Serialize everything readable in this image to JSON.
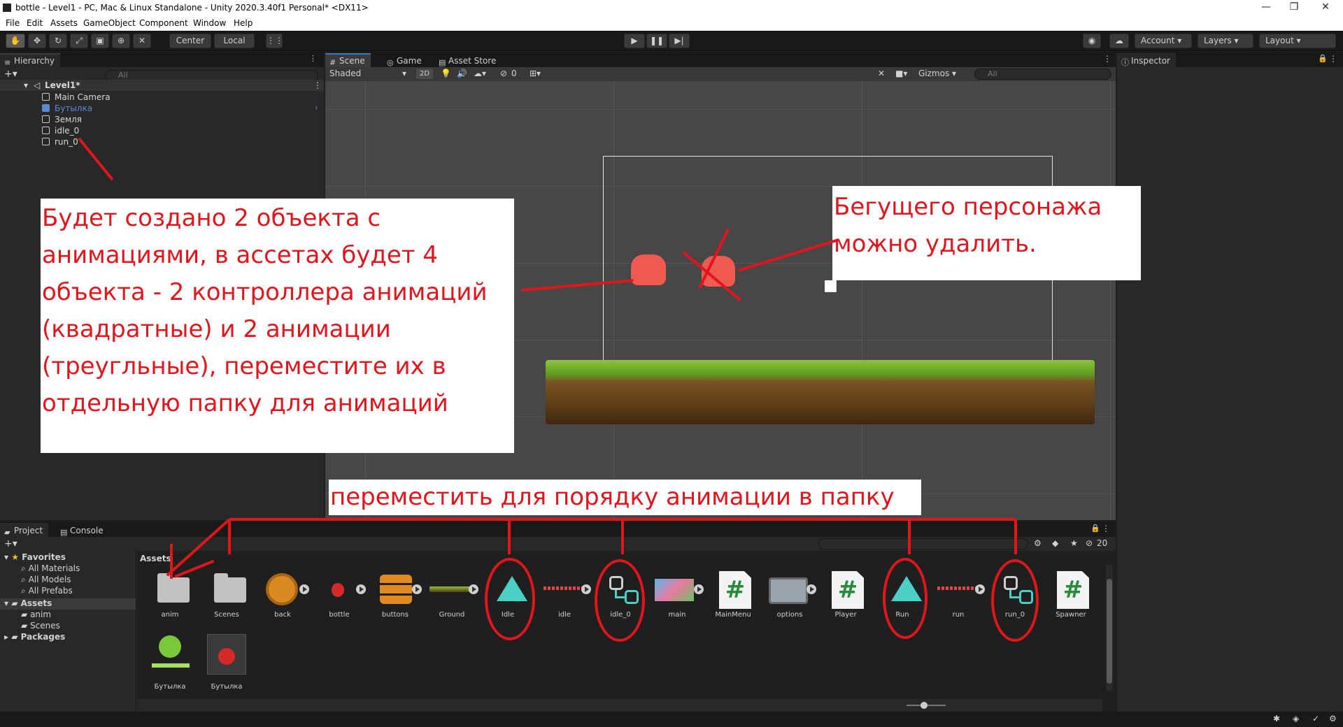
{
  "window": {
    "title": "bottle - Level1 - PC, Mac & Linux Standalone - Unity 2020.3.40f1 Personal* <DX11>",
    "min": "—",
    "max": "❐",
    "close": "✕"
  },
  "menu": [
    "File",
    "Edit",
    "Assets",
    "GameObject",
    "Component",
    "Window",
    "Help"
  ],
  "toolbar": {
    "center": "Center",
    "local": "Local",
    "account": "Account",
    "layers": "Layers",
    "layout": "Layout"
  },
  "hierarchy": {
    "tab": "Hierarchy",
    "search_placeholder": "All",
    "scene": "Level1*",
    "items": [
      "Main Camera",
      "Бутылка",
      "Земля",
      "idle_0",
      "run_0"
    ]
  },
  "scene": {
    "tabs": [
      "Scene",
      "Game",
      "Asset Store"
    ],
    "shading": "Shaded",
    "mode2d": "2D",
    "gizmos": "Gizmos",
    "search_placeholder": "All",
    "hidden_count": "0"
  },
  "inspector": {
    "tab": "Inspector"
  },
  "project": {
    "tabs": [
      "Project",
      "Console"
    ],
    "breadcrumb": "Assets",
    "count": "20",
    "tree": {
      "favorites": "Favorites",
      "fav_items": [
        "All Materials",
        "All Models",
        "All Prefabs"
      ],
      "assets": "Assets",
      "asset_folders": [
        "anim",
        "Scenes"
      ],
      "packages": "Packages"
    },
    "assets": [
      "anim",
      "Scenes",
      "back",
      "bottle",
      "buttons",
      "Ground",
      "Idle",
      "idle",
      "idle_0",
      "main",
      "MainMenu",
      "options",
      "Player",
      "Run",
      "run",
      "run_0",
      "Spawner",
      "Бутылка",
      "Бутылка"
    ]
  },
  "annotations": {
    "left": "Будет создано 2 объекта с анимациями, в ассетах будет 4 объекта - 2 контроллера анимаций (квадратные) и 2 анимации (треугльные), переместите их в отдельную папку для анимаций",
    "right": "Бегущего персонажа можно удалить.",
    "bottom": "переместить для порядку анимации в папку"
  },
  "colors": {
    "accent": "#3a79bb",
    "annotation": "#e0161c",
    "anim": "#4ad0c5"
  }
}
